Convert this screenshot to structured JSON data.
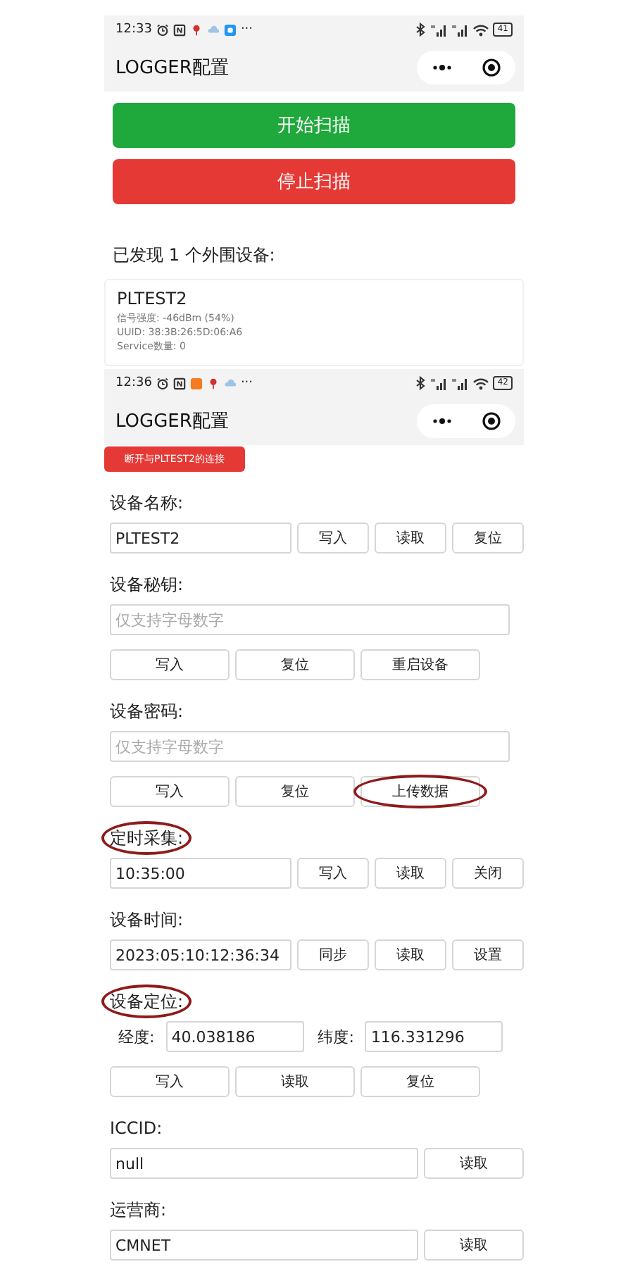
{
  "scan_screen": {
    "status_bar": {
      "time": "12:33",
      "more": "···",
      "battery": "41"
    },
    "nav_bar": {
      "title": "LOGGER配置"
    },
    "actions": [
      {
        "kind": "start",
        "label": "开始扫描"
      },
      {
        "kind": "stop",
        "label": "停止扫描"
      }
    ],
    "found_text": "已发现 1 个外围设备:",
    "devices": [
      {
        "name": "PLTEST2",
        "details": [
          "信号强度: -46dBm (54%)",
          "UUID: 38:3B:26:5D:06:A6",
          "Service数量: 0"
        ]
      }
    ]
  },
  "config_screen": {
    "status_bar": {
      "time": "12:36",
      "more": "···",
      "battery": "42"
    },
    "nav_bar": {
      "title": "LOGGER配置"
    },
    "disconnect_button": "断开与PLTEST2的连接",
    "sections": [
      {
        "kind": "inline",
        "label": "设备名称:",
        "highlighted": false,
        "field": {
          "value": "PLTEST2"
        },
        "buttons": [
          {
            "label": "写入",
            "highlighted": false
          },
          {
            "label": "读取",
            "highlighted": false
          },
          {
            "label": "复位",
            "highlighted": false
          }
        ]
      },
      {
        "kind": "stacked",
        "label": "设备秘钥:",
        "highlighted": false,
        "field": {
          "placeholder": "仅支持字母数字"
        },
        "buttons": [
          {
            "label": "写入",
            "highlighted": false
          },
          {
            "label": "复位",
            "highlighted": false
          },
          {
            "label": "重启设备",
            "highlighted": false
          }
        ]
      },
      {
        "kind": "stacked",
        "label": "设备密码:",
        "highlighted": false,
        "field": {
          "placeholder": "仅支持字母数字"
        },
        "buttons": [
          {
            "label": "写入",
            "highlighted": false
          },
          {
            "label": "复位",
            "highlighted": false
          },
          {
            "label": "上传数据",
            "highlighted": true
          }
        ]
      },
      {
        "kind": "inline",
        "label": "定时采集:",
        "highlighted": true,
        "field": {
          "value": "10:35:00"
        },
        "buttons": [
          {
            "label": "写入",
            "highlighted": false
          },
          {
            "label": "读取",
            "highlighted": false
          },
          {
            "label": "关闭",
            "highlighted": false
          }
        ]
      },
      {
        "kind": "inline",
        "label": "设备时间:",
        "highlighted": false,
        "field": {
          "value": "2023:05:10:12:36:34"
        },
        "buttons": [
          {
            "label": "同步",
            "highlighted": false
          },
          {
            "label": "读取",
            "highlighted": false
          },
          {
            "label": "设置",
            "highlighted": false
          }
        ]
      },
      {
        "kind": "coords",
        "label": "设备定位:",
        "highlighted": true,
        "fields": [
          {
            "label": "经度:",
            "value": "40.038186"
          },
          {
            "label": "纬度:",
            "value": "116.331296"
          }
        ],
        "buttons": [
          {
            "label": "写入",
            "highlighted": false
          },
          {
            "label": "读取",
            "highlighted": false
          },
          {
            "label": "复位",
            "highlighted": false
          }
        ]
      },
      {
        "kind": "inline",
        "label": "ICCID:",
        "highlighted": false,
        "field": {
          "value": "null"
        },
        "buttons": [
          {
            "label": "读取",
            "highlighted": false
          }
        ]
      },
      {
        "kind": "inline",
        "label": "运营商:",
        "highlighted": false,
        "field": {
          "value": "CMNET"
        },
        "buttons": [
          {
            "label": "读取",
            "highlighted": false
          }
        ]
      }
    ]
  }
}
